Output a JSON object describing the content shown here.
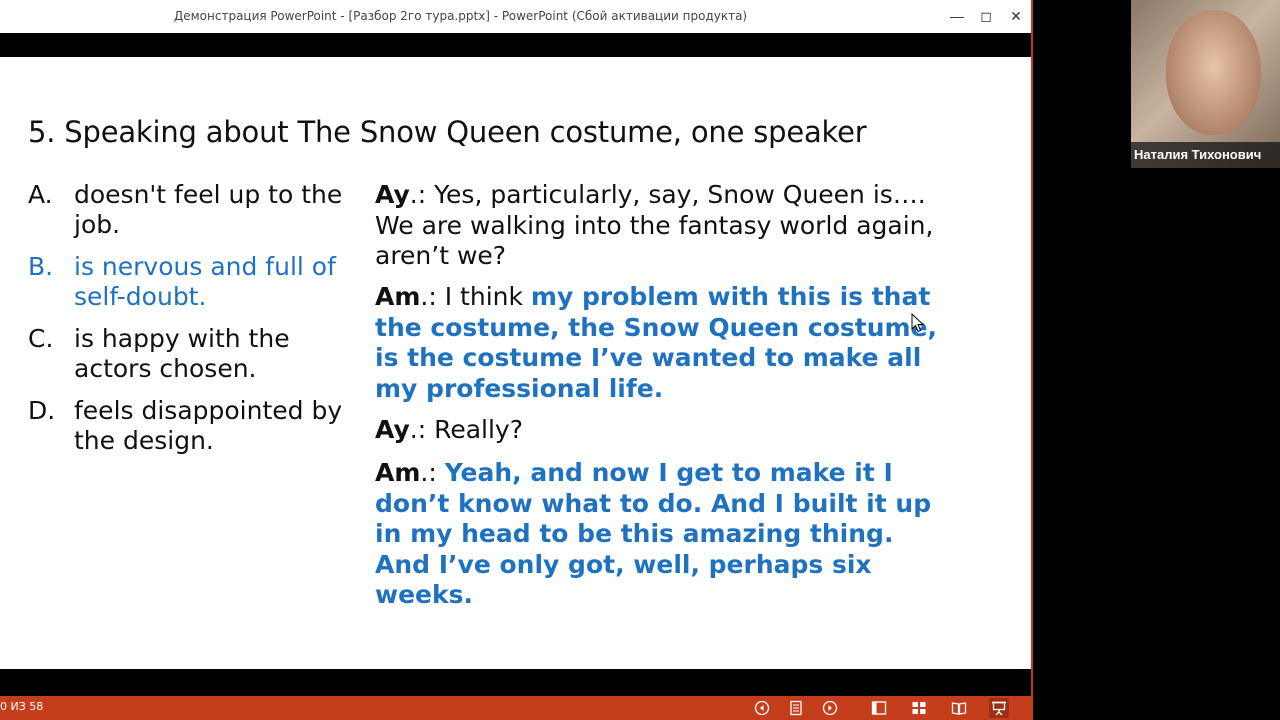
{
  "window": {
    "title": "Демонстрация PowerPoint - [Разбор 2го тура.pptx] - PowerPoint (Сбой активации продукта)",
    "minimize_glyph": "—",
    "maximize_glyph": "◻",
    "close_glyph": "✕"
  },
  "slide": {
    "title": "5. Speaking about The Snow Queen costume, one speaker",
    "options": [
      {
        "letter": "A.",
        "text": "doesn't feel up to the job."
      },
      {
        "letter": "B.",
        "text": "is nervous and full of self-doubt."
      },
      {
        "letter": "C.",
        "text": "is happy with the actors chosen."
      },
      {
        "letter": "D.",
        "text": "feels disappointed by the design."
      }
    ],
    "highlight_color": "#1f72c0",
    "dialogue": [
      {
        "speaker": "Ay",
        "sep": ".: ",
        "plain": "Yes, particularly, say, Snow Queen is…. We are walking into the fantasy world again, aren’t we?",
        "highlight": ""
      },
      {
        "speaker": "Am",
        "sep": ".:   ",
        "plain": "I think ",
        "highlight": "my problem with this is that the costume, the Snow Queen costume, is the costume I’ve wanted to make all my professional life."
      },
      {
        "speaker": "Ay",
        "sep": ".:    ",
        "plain": "Really?",
        "highlight": ""
      },
      {
        "speaker": "Am",
        "sep": ".:   ",
        "plain": "",
        "highlight": "Yeah, and now I get to make it I don’t know what to do. And I built it up in my head to be this amazing thing. And I’ve only got, well, perhaps six weeks."
      }
    ]
  },
  "statusbar": {
    "slide_counter": "0 ИЗ 58",
    "accent_color": "#c43e1c",
    "buttons": [
      "previous-icon",
      "notes-icon",
      "next-icon",
      "normal-view-icon",
      "slide-sorter-icon",
      "reading-view-icon",
      "slideshow-icon"
    ]
  },
  "webcam": {
    "participant_name": "Наталия Тихонович"
  }
}
